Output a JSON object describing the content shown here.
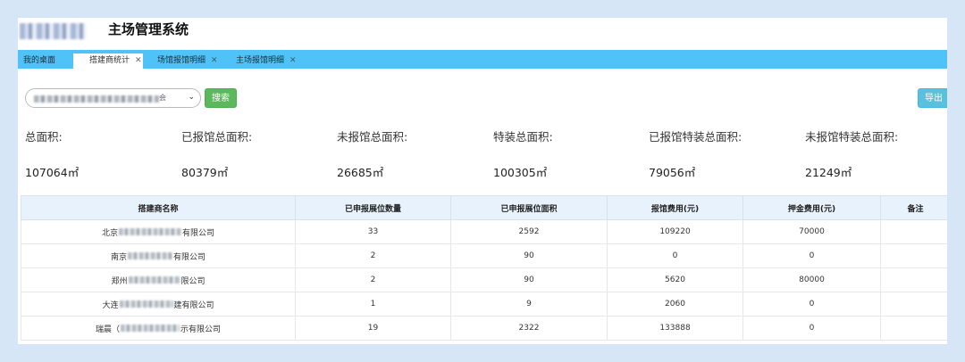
{
  "app": {
    "title": "主场管理系统"
  },
  "tabs": [
    {
      "label": "我的桌面",
      "closable": false,
      "active": false
    },
    {
      "label": "搭建商统计",
      "closable": true,
      "active": true
    },
    {
      "label": "场馆报馆明细",
      "closable": true,
      "active": false
    },
    {
      "label": "主场报馆明细",
      "closable": true,
      "active": false
    }
  ],
  "toolbar": {
    "select_value_suffix": "会",
    "search_label": "搜索",
    "export_label": "导出"
  },
  "stats": [
    {
      "label": "总面积:",
      "value": "107064㎡"
    },
    {
      "label": "已报馆总面积:",
      "value": "80379㎡"
    },
    {
      "label": "未报馆总面积:",
      "value": "26685㎡"
    },
    {
      "label": "特装总面积:",
      "value": "100305㎡"
    },
    {
      "label": "已报馆特装总面积:",
      "value": "79056㎡"
    },
    {
      "label": "未报馆特装总面积:",
      "value": "21249㎡"
    }
  ],
  "table": {
    "columns": [
      "搭建商名称",
      "已申报展位数量",
      "已申报展位面积",
      "报馆费用(元)",
      "押金费用(元)",
      "备注"
    ],
    "rows": [
      {
        "name_prefix": "北京",
        "name_suffix": "有限公司",
        "booths": "33",
        "area": "2592",
        "fee": "109220",
        "deposit": "70000",
        "note": ""
      },
      {
        "name_prefix": "南京",
        "name_suffix": "有限公司",
        "booths": "2",
        "area": "90",
        "fee": "0",
        "deposit": "0",
        "note": ""
      },
      {
        "name_prefix": "郑州",
        "name_suffix": "限公司",
        "booths": "2",
        "area": "90",
        "fee": "5620",
        "deposit": "80000",
        "note": ""
      },
      {
        "name_prefix": "大连",
        "name_suffix": "建有限公司",
        "booths": "1",
        "area": "9",
        "fee": "2060",
        "deposit": "0",
        "note": ""
      },
      {
        "name_prefix": "瑞晨（",
        "name_suffix": "示有限公司",
        "booths": "19",
        "area": "2322",
        "fee": "133888",
        "deposit": "0",
        "note": ""
      }
    ]
  },
  "colors": {
    "tabbar": "#4fc3f7",
    "search_button": "#5cb85c",
    "export_button": "#5bc0de",
    "table_header": "#e8f2fc"
  }
}
